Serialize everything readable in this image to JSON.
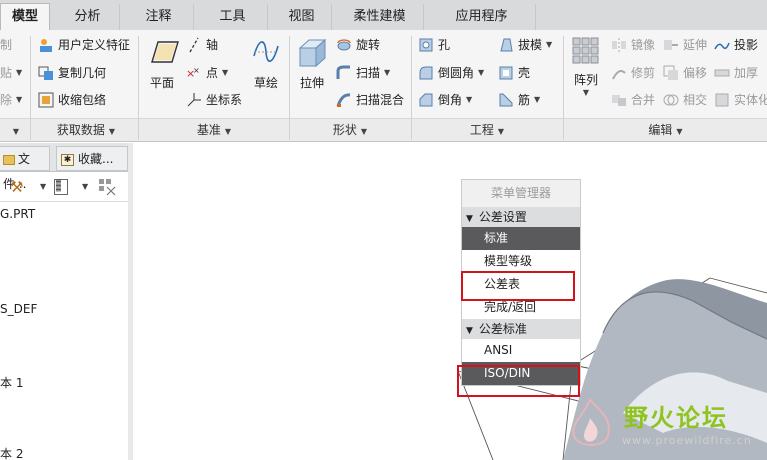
{
  "tabs": [
    {
      "label": "模型",
      "active": true
    },
    {
      "label": "分析"
    },
    {
      "label": "注释"
    },
    {
      "label": "工具"
    },
    {
      "label": "视图"
    },
    {
      "label": "柔性建模"
    },
    {
      "label": "应用程序"
    }
  ],
  "ribbon": {
    "left_cut": {
      "item1": "制",
      "item2": "贴",
      "item3": "除"
    },
    "get_data": {
      "label": "获取数据",
      "user_feature": "用户定义特征",
      "copy_geometry": "复制几何",
      "shrinkwrap": "收缩包络"
    },
    "datum": {
      "label": "基准",
      "plane": "平面",
      "axis": "轴",
      "point": "点",
      "csys": "坐标系",
      "sketch": "草绘"
    },
    "shapes": {
      "label": "形状",
      "extrude": "拉伸",
      "revolve": "旋转",
      "sweep": "扫描",
      "swept_blend": "扫描混合"
    },
    "engineering": {
      "label": "工程",
      "hole": "孔",
      "round": "倒圆角",
      "chamfer": "倒角",
      "draft": "拔模",
      "shell": "壳",
      "rib": "筋"
    },
    "editing": {
      "label": "编辑",
      "pattern": "阵列",
      "mirror": "镜像",
      "trim": "修剪",
      "merge": "合并",
      "extend": "延伸",
      "offset": "偏移",
      "intersect": "相交",
      "project": "投影",
      "thicken": "加厚",
      "solidify": "实体化"
    }
  },
  "left_panel": {
    "tab_files": "文件...",
    "tab_favorites": "收藏...",
    "tree": [
      "G.PRT",
      "S_DEF",
      "本 1",
      "本 2"
    ]
  },
  "menu_manager": {
    "title": "菜单管理器",
    "section_tolerance_setup": "公差设置",
    "items_setup": [
      {
        "label": "标准",
        "selected": true
      },
      {
        "label": "模型等级",
        "selected": false
      },
      {
        "label": "公差表",
        "selected": false,
        "highlighted": true
      },
      {
        "label": "完成/返回",
        "selected": false
      }
    ],
    "section_tolerance_standard": "公差标准",
    "items_standard": [
      {
        "label": "ANSI",
        "selected": false
      },
      {
        "label": "ISO/DIN",
        "selected": true,
        "highlighted": true
      }
    ]
  },
  "watermark": {
    "text": "野火论坛",
    "url": "www.proewildfire.cn"
  },
  "colors": {
    "highlight_box": "#d4121b",
    "selected_item": "#5a5a5c",
    "watermark": "#8fc31f"
  }
}
